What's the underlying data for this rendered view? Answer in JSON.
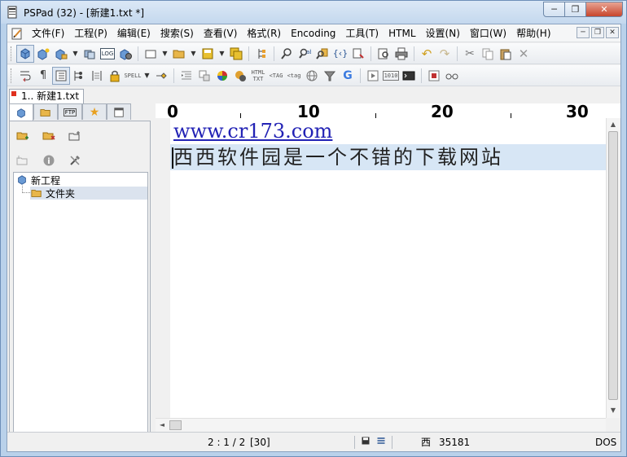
{
  "window": {
    "title": "PSPad (32) - [新建1.txt *]",
    "controls": {
      "minimize": "─",
      "maximize": "❐",
      "close": "✕"
    }
  },
  "menubar": {
    "items": [
      "文件(F)",
      "工程(P)",
      "编辑(E)",
      "搜索(S)",
      "查看(V)",
      "格式(R)",
      "Encoding",
      "工具(T)",
      "HTML",
      "设置(N)",
      "窗口(W)",
      "帮助(H)"
    ],
    "mdi_controls": {
      "minimize": "─",
      "restore": "❐",
      "close": "✕"
    }
  },
  "toolbar1": {
    "icons": [
      "projects-icon",
      "new-project-icon",
      "open-project-icon",
      "save-project-icon",
      "close-project-icon",
      "log-icon",
      "compile-icon",
      "new-file-icon",
      "open-file-icon",
      "save-icon",
      "save-all-icon",
      "structure-icon",
      "find-icon",
      "replace-icon",
      "find-in-files-icon",
      "match-bracket-icon",
      "preview-icon",
      "print-icon",
      "undo-icon",
      "redo-icon",
      "cut-icon",
      "copy-icon",
      "paste-icon",
      "delete-icon"
    ],
    "log_label": "LOG"
  },
  "toolbar2": {
    "icons": [
      "wrap-icon",
      "pilcrow-icon",
      "line-numbers-icon",
      "tree-icon",
      "column-block-icon",
      "read-only-icon",
      "spell-icon",
      "pin-icon",
      "indent-icon",
      "code-explorer-icon",
      "color-picker-icon",
      "html-to-text-icon",
      "strip-tags-icon",
      "tag-icon",
      "web-icon",
      "filter-icon",
      "google-icon",
      "play-macro-icon",
      "binary-icon",
      "console-icon",
      "record-macro-icon",
      "glasses-icon"
    ],
    "spell_label": "SPELL",
    "html_txt_label": "HTML TXT",
    "strip_label": "<TAG",
    "tag_label": "<tag",
    "binary_label": "1010",
    "google_label": "G"
  },
  "tabs": {
    "documents": [
      {
        "label": "1.. 新建1.txt",
        "modified": true
      }
    ]
  },
  "sidepanel": {
    "tabs": [
      "projects-tab",
      "files-tab",
      "ftp-tab",
      "favorites-tab",
      "windows-tab"
    ],
    "ftp_label": "FTP",
    "tree": [
      {
        "label": "新工程",
        "type": "project"
      },
      {
        "label": "文件夹",
        "type": "folder",
        "selected": true
      }
    ]
  },
  "editor": {
    "ruler": [
      "0",
      "10",
      "20",
      "30"
    ],
    "lines": [
      "www.cr173.com",
      "西西软件园是一个不错的下载网站"
    ]
  },
  "statusbar": {
    "position": "2 : 1 / 2",
    "column": "[30]",
    "char": "西",
    "code": "35181",
    "line_end": "DOS"
  },
  "colors": {
    "link": "#2222b5",
    "current_line": "#d7e6f5",
    "titlebar": "#c4d8ee",
    "close_button": "#c7452c"
  }
}
